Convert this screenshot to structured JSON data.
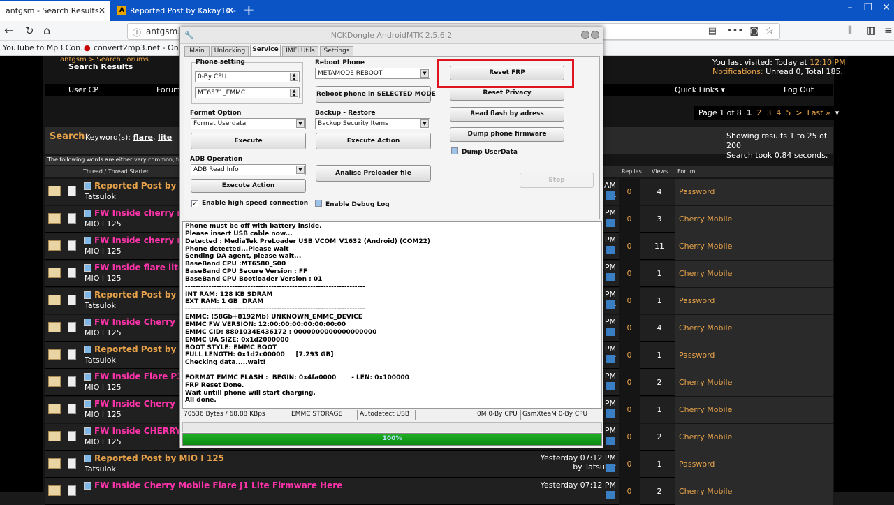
{
  "browser": {
    "tabs": [
      {
        "label": "antgsm - Search Results"
      },
      {
        "label": "Reported Post by Kakay16 - ant"
      }
    ],
    "url": "antgsm.com",
    "bookmarks": [
      "YouTube to Mp3 Con...",
      "convert2mp3.net - On..."
    ]
  },
  "forum": {
    "breadcrumb": "antgsm > Search Forums",
    "page_title": "Search Results",
    "last_visited": "You last visited: Today at",
    "last_visited_time": "12:10 PM",
    "notifications_label": "Notifications:",
    "notifications": "Unread 0, Total 185.",
    "nav": {
      "user_cp": "User CP",
      "forum": "Forum",
      "quick_links": "Quick Links",
      "logout": "Log Out"
    },
    "pager": {
      "label": "Page 1 of 8",
      "current": "1",
      "pages": [
        "2",
        "3",
        "4",
        "5",
        ">",
        "Last »"
      ]
    },
    "search_label": "Search:",
    "keywords_label": "Keyword(s):",
    "keywords": [
      "flare",
      "lite"
    ],
    "results_text": "Showing results 1 to 25 of 200",
    "search_time": "Search took 0.84 seconds.",
    "common_words_note": "The following words are either very common, too lo",
    "columns": {
      "thread": "Thread / Thread Starter",
      "replies": "Replies",
      "views": "Views",
      "forum": "Forum"
    },
    "threads": [
      {
        "title": "Reported Post by Kak",
        "color": "#e8a34a",
        "starter": "Tatsulok",
        "time": "AM",
        "last_by": "k",
        "replies": "0",
        "views": "4",
        "forum": "Password"
      },
      {
        "title": "FW Inside cherry mo",
        "color": "#ff33aa",
        "starter": "MIO I 125",
        "time": "PM",
        "last_by": "25",
        "replies": "0",
        "views": "3",
        "forum": "Cherry Mobile"
      },
      {
        "title": "FW Inside cherry mo",
        "color": "#ff33aa",
        "starter": "MIO I 125",
        "time": "PM",
        "last_by": "25",
        "replies": "0",
        "views": "11",
        "forum": "Cherry Mobile"
      },
      {
        "title": "FW Inside flare lite 2",
        "color": "#ff33aa",
        "starter": "MIO I 125",
        "time": "PM",
        "last_by": "25",
        "replies": "0",
        "views": "1",
        "forum": "Cherry Mobile"
      },
      {
        "title": "Reported Post by MIC",
        "color": "#e8a34a",
        "starter": "Tatsulok",
        "time": "PM",
        "last_by": "k",
        "replies": "0",
        "views": "1",
        "forum": "Password"
      },
      {
        "title": "FW Inside Cherry Mo",
        "color": "#ff33aa",
        "starter": "MIO I 125",
        "time": "PM",
        "last_by": "25",
        "replies": "0",
        "views": "4",
        "forum": "Cherry Mobile"
      },
      {
        "title": "Reported Post by MIC",
        "color": "#e8a34a",
        "starter": "Tatsulok",
        "time": "PM",
        "last_by": "k",
        "replies": "0",
        "views": "1",
        "forum": "Password"
      },
      {
        "title": "FW Inside Flare P3 Li",
        "color": "#ff33aa",
        "starter": "MIO I 125",
        "time": "PM",
        "last_by": "25",
        "replies": "0",
        "views": "2",
        "forum": "Cherry Mobile"
      },
      {
        "title": "FW Inside Cherry Mo",
        "color": "#ff33aa",
        "starter": "MIO I 125",
        "time": "PM",
        "last_by": "25",
        "replies": "0",
        "views": "1",
        "forum": "Cherry Mobile"
      },
      {
        "title": "FW Inside CHERRY M",
        "color": "#ff33aa",
        "starter": "MIO I 125",
        "time": "PM",
        "last_by": "25",
        "replies": "0",
        "views": "2",
        "forum": "Cherry Mobile"
      },
      {
        "title": "Reported Post by MIO I 125",
        "color": "#e8a34a",
        "starter": "Tatsulok",
        "time": "Yesterday 07:12 PM",
        "last_by": "by Tatsulok",
        "replies": "0",
        "views": "1",
        "forum": "Password"
      },
      {
        "title": "FW Inside Cherry Mobile Flare J1 Lite Firmware Here",
        "color": "#ff33aa",
        "starter": "",
        "time": "Yesterday 07:12 PM",
        "last_by": "",
        "replies": "0",
        "views": "2",
        "forum": "Cherry Mobile"
      }
    ]
  },
  "app": {
    "title": "NCKDongle AndroidMTK 2.5.6.2",
    "tabs": [
      "Main",
      "Unlocking",
      "Service",
      "IMEI Utils",
      "Settings"
    ],
    "active_tab": "Service",
    "phone_setting_label": "Phone setting",
    "cpu_value": "0-By CPU",
    "storage_value": "MT6571_EMMC",
    "format_option_label": "Format Option",
    "format_value": "Format Userdata",
    "execute_label": "Execute",
    "adb_label": "ADB Operation",
    "adb_value": "ADB Read Info",
    "execute_action_label": "Execute Action",
    "high_speed_label": "Enable high speed connection",
    "reboot_label": "Reboot Phone",
    "reboot_value": "METAMODE REBOOT",
    "reboot_btn": "Reboot phone in SELECTED MODE",
    "backup_label": "Backup - Restore",
    "backup_value": "Backup Security Items",
    "execute_action2": "Execute Action",
    "analise_btn": "Analise Preloader file",
    "debug_log_label": "Enable Debug Log",
    "reset_frp": "Reset FRP",
    "reset_privacy": "Reset Privacy",
    "read_flash": "Read flash by adress",
    "dump_firmware": "Dump phone firmware",
    "dump_userdata": "Dump UserData",
    "stop": "Stop",
    "log": "Phone must be off with battery inside.\nPlease insert USB cable now...\nDetected : MediaTek PreLoader USB VCOM_V1632 (Android) (COM22)\nPhone detected...Please wait\nSending DA agent, please wait...\nBaseBand CPU :MT6580_S00\nBaseBand CPU Secure Version : FF\nBaseBand CPU Bootloader Version : 01\n---------------------------------------------------------------------\nINT RAM: 128 KB SDRAM\nEXT RAM: 1 GB  DRAM\n---------------------------------------------------------------------\nEMMC: (58Gb+8192Mb) UNKNOWN_EMMC_DEVICE\nEMMC FW VERSION: 12:00:00:00:00:00:00:00\nEMMC CID: 8801034E436172 : 0000000000000000000\nEMMC UA SIZE: 0x1d2000000\nBOOT STYLE: EMMC BOOT\nFULL LENGTH: 0x1d2c00000     [7.293 GB]\nChecking data.....wait!\n\nFORMAT EMMC FLASH :  BEGIN: 0x4fa0000       - LEN: 0x100000\nFRP Reset Done.\nWait untill phone will start charging.\nAll done.",
    "status": {
      "speed": "70536 Bytes / 68.88 KBps",
      "storage": "EMMC STORAGE",
      "port": "Autodetect USB",
      "mem": "0M 0-By CPU",
      "model": "GsmXteaM 0-By CPU"
    },
    "progress": 100,
    "progress_label": "100%"
  }
}
